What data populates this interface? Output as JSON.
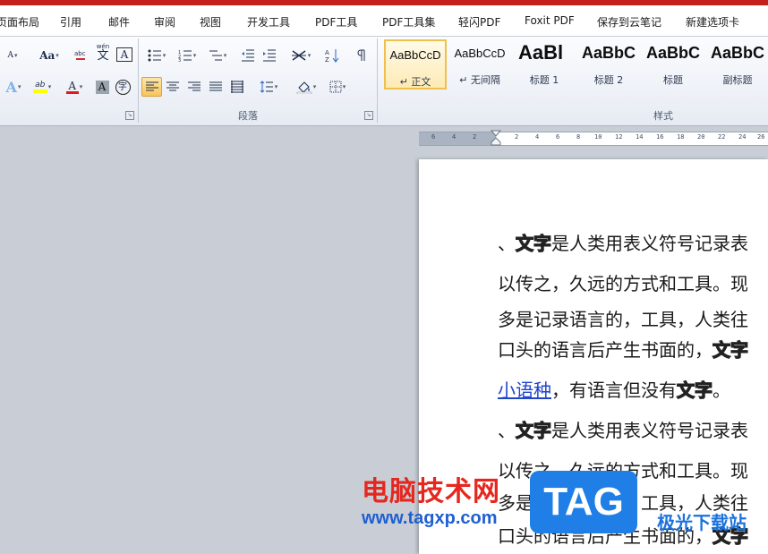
{
  "window": {
    "accent": "#c4201b"
  },
  "menu": {
    "items": [
      "页面布局",
      "引用",
      "邮件",
      "审阅",
      "视图",
      "开发工具",
      "PDF工具",
      "PDF工具集",
      "轻闪PDF",
      "Foxit PDF",
      "保存到云笔记",
      "新建选项卡"
    ]
  },
  "ribbon": {
    "font_group": {
      "shrink_font_label": "A",
      "change_case_label": "Aa",
      "wen_label": "wén",
      "wen_char": "文",
      "border_char_label": "A",
      "highlight_label": "ab",
      "font_color_label": "A",
      "char_shading_label": "A",
      "enclose_char_label": "字"
    },
    "paragraph_group": {
      "label": "段落"
    },
    "styles_group": {
      "label": "样式",
      "styles": [
        {
          "sample": "AaBbCcD",
          "name": "↵ 正文",
          "active": true
        },
        {
          "sample": "AaBbCcD",
          "name": "↵ 无间隔",
          "active": false
        },
        {
          "sample": "AaBl",
          "name": "标题 1",
          "active": false
        },
        {
          "sample": "AaBbC",
          "name": "标题 2",
          "active": false
        },
        {
          "sample": "AaBbC",
          "name": "标题",
          "active": false
        },
        {
          "sample": "AaBbC",
          "name": "副标题",
          "active": false
        }
      ]
    }
  },
  "ruler": {
    "ticks": [
      "6",
      "4",
      "2",
      "2",
      "4",
      "6",
      "8",
      "10",
      "12",
      "14",
      "16",
      "18",
      "20",
      "22",
      "24",
      "26"
    ]
  },
  "document": {
    "lines": [
      {
        "pre": "、",
        "outline": "文字",
        "post": "是人类用表义符号记录表"
      },
      {
        "pre": "以传之，久远的方式和工具。现",
        "outline": "",
        "post": ""
      },
      {
        "pre": "多是记录语言的，工具，人类往",
        "outline": "",
        "post": ""
      },
      {
        "pre": "口头的语言后产生书面的，",
        "outline": "文字",
        "post": ""
      },
      {
        "link": "小语种",
        "pre": "，有语言但没有",
        "outline": "文字",
        "post": "。"
      },
      {
        "pre": "、",
        "outline": "文字",
        "post": "是人类用表义符号记录表"
      },
      {
        "pre": "以传之，久远的方式和工具。现",
        "outline": "",
        "post": ""
      },
      {
        "pre": "多是记录语言的，工具，人类往",
        "outline": "",
        "post": ""
      },
      {
        "pre": "口头的语言后产生书面的，",
        "outline": "文字",
        "post": ""
      }
    ]
  },
  "watermark": {
    "cn": "电脑技术网",
    "url": "www.tagxp.com",
    "tag": "TAG",
    "site": "极光下载站"
  }
}
